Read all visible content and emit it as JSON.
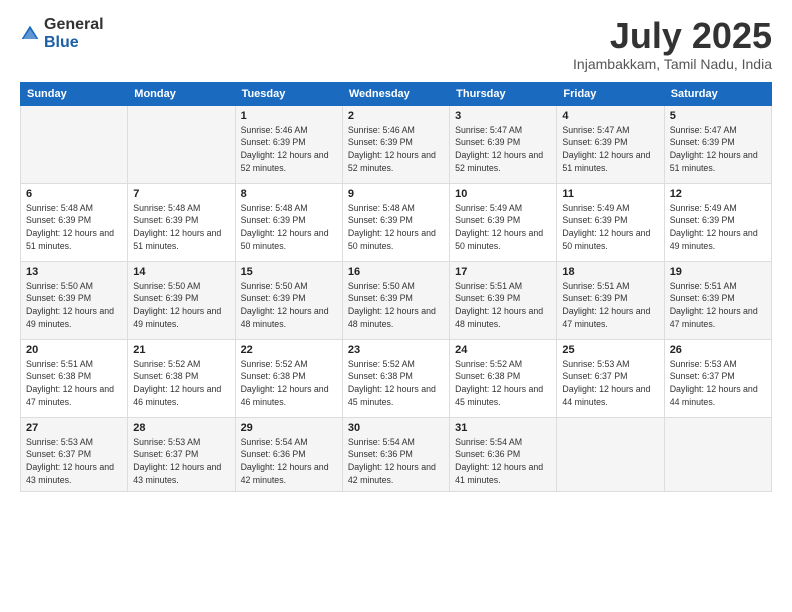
{
  "logo": {
    "general": "General",
    "blue": "Blue"
  },
  "header": {
    "month": "July 2025",
    "location": "Injambakkam, Tamil Nadu, India"
  },
  "weekdays": [
    "Sunday",
    "Monday",
    "Tuesday",
    "Wednesday",
    "Thursday",
    "Friday",
    "Saturday"
  ],
  "weeks": [
    [
      {
        "day": "",
        "info": ""
      },
      {
        "day": "",
        "info": ""
      },
      {
        "day": "1",
        "info": "Sunrise: 5:46 AM\nSunset: 6:39 PM\nDaylight: 12 hours and 52 minutes."
      },
      {
        "day": "2",
        "info": "Sunrise: 5:46 AM\nSunset: 6:39 PM\nDaylight: 12 hours and 52 minutes."
      },
      {
        "day": "3",
        "info": "Sunrise: 5:47 AM\nSunset: 6:39 PM\nDaylight: 12 hours and 52 minutes."
      },
      {
        "day": "4",
        "info": "Sunrise: 5:47 AM\nSunset: 6:39 PM\nDaylight: 12 hours and 51 minutes."
      },
      {
        "day": "5",
        "info": "Sunrise: 5:47 AM\nSunset: 6:39 PM\nDaylight: 12 hours and 51 minutes."
      }
    ],
    [
      {
        "day": "6",
        "info": "Sunrise: 5:48 AM\nSunset: 6:39 PM\nDaylight: 12 hours and 51 minutes."
      },
      {
        "day": "7",
        "info": "Sunrise: 5:48 AM\nSunset: 6:39 PM\nDaylight: 12 hours and 51 minutes."
      },
      {
        "day": "8",
        "info": "Sunrise: 5:48 AM\nSunset: 6:39 PM\nDaylight: 12 hours and 50 minutes."
      },
      {
        "day": "9",
        "info": "Sunrise: 5:48 AM\nSunset: 6:39 PM\nDaylight: 12 hours and 50 minutes."
      },
      {
        "day": "10",
        "info": "Sunrise: 5:49 AM\nSunset: 6:39 PM\nDaylight: 12 hours and 50 minutes."
      },
      {
        "day": "11",
        "info": "Sunrise: 5:49 AM\nSunset: 6:39 PM\nDaylight: 12 hours and 50 minutes."
      },
      {
        "day": "12",
        "info": "Sunrise: 5:49 AM\nSunset: 6:39 PM\nDaylight: 12 hours and 49 minutes."
      }
    ],
    [
      {
        "day": "13",
        "info": "Sunrise: 5:50 AM\nSunset: 6:39 PM\nDaylight: 12 hours and 49 minutes."
      },
      {
        "day": "14",
        "info": "Sunrise: 5:50 AM\nSunset: 6:39 PM\nDaylight: 12 hours and 49 minutes."
      },
      {
        "day": "15",
        "info": "Sunrise: 5:50 AM\nSunset: 6:39 PM\nDaylight: 12 hours and 48 minutes."
      },
      {
        "day": "16",
        "info": "Sunrise: 5:50 AM\nSunset: 6:39 PM\nDaylight: 12 hours and 48 minutes."
      },
      {
        "day": "17",
        "info": "Sunrise: 5:51 AM\nSunset: 6:39 PM\nDaylight: 12 hours and 48 minutes."
      },
      {
        "day": "18",
        "info": "Sunrise: 5:51 AM\nSunset: 6:39 PM\nDaylight: 12 hours and 47 minutes."
      },
      {
        "day": "19",
        "info": "Sunrise: 5:51 AM\nSunset: 6:39 PM\nDaylight: 12 hours and 47 minutes."
      }
    ],
    [
      {
        "day": "20",
        "info": "Sunrise: 5:51 AM\nSunset: 6:38 PM\nDaylight: 12 hours and 47 minutes."
      },
      {
        "day": "21",
        "info": "Sunrise: 5:52 AM\nSunset: 6:38 PM\nDaylight: 12 hours and 46 minutes."
      },
      {
        "day": "22",
        "info": "Sunrise: 5:52 AM\nSunset: 6:38 PM\nDaylight: 12 hours and 46 minutes."
      },
      {
        "day": "23",
        "info": "Sunrise: 5:52 AM\nSunset: 6:38 PM\nDaylight: 12 hours and 45 minutes."
      },
      {
        "day": "24",
        "info": "Sunrise: 5:52 AM\nSunset: 6:38 PM\nDaylight: 12 hours and 45 minutes."
      },
      {
        "day": "25",
        "info": "Sunrise: 5:53 AM\nSunset: 6:37 PM\nDaylight: 12 hours and 44 minutes."
      },
      {
        "day": "26",
        "info": "Sunrise: 5:53 AM\nSunset: 6:37 PM\nDaylight: 12 hours and 44 minutes."
      }
    ],
    [
      {
        "day": "27",
        "info": "Sunrise: 5:53 AM\nSunset: 6:37 PM\nDaylight: 12 hours and 43 minutes."
      },
      {
        "day": "28",
        "info": "Sunrise: 5:53 AM\nSunset: 6:37 PM\nDaylight: 12 hours and 43 minutes."
      },
      {
        "day": "29",
        "info": "Sunrise: 5:54 AM\nSunset: 6:36 PM\nDaylight: 12 hours and 42 minutes."
      },
      {
        "day": "30",
        "info": "Sunrise: 5:54 AM\nSunset: 6:36 PM\nDaylight: 12 hours and 42 minutes."
      },
      {
        "day": "31",
        "info": "Sunrise: 5:54 AM\nSunset: 6:36 PM\nDaylight: 12 hours and 41 minutes."
      },
      {
        "day": "",
        "info": ""
      },
      {
        "day": "",
        "info": ""
      }
    ]
  ]
}
